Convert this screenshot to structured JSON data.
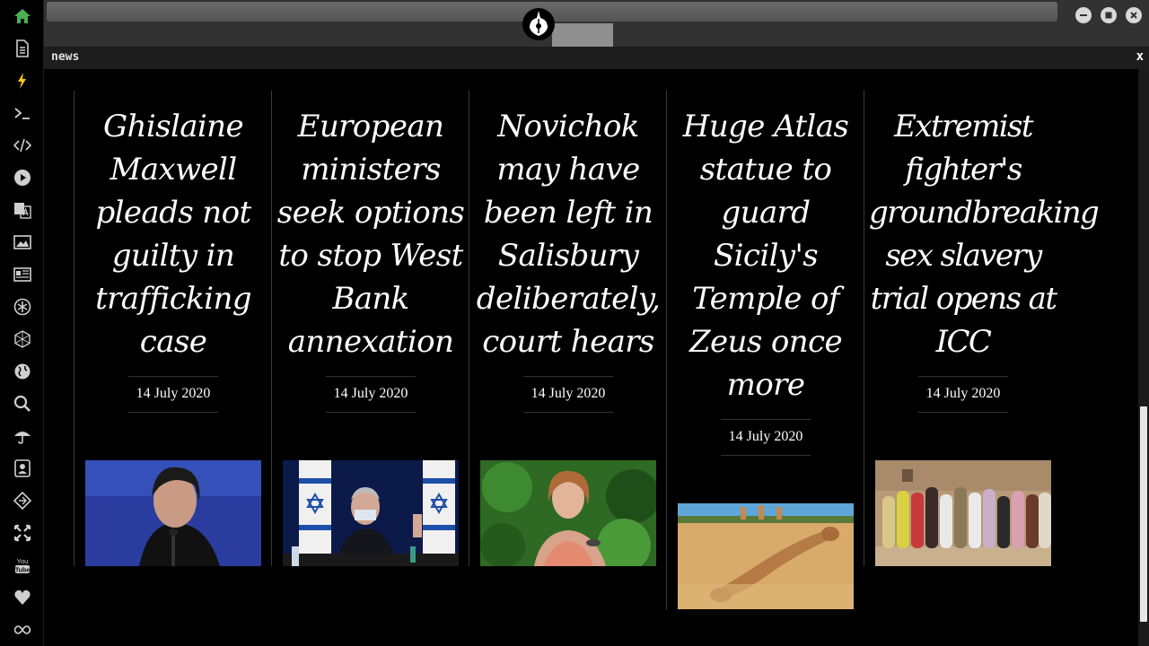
{
  "window": {
    "tab_title": "news",
    "close_glyph": "x"
  },
  "colors": {
    "accent_home": "#4caf50",
    "accent_lightning": "#f5c518",
    "sidebar_icon": "#cfcfcf",
    "background": "#000000"
  },
  "sidebar": {
    "items": [
      {
        "icon": "home-icon"
      },
      {
        "icon": "document-icon"
      },
      {
        "icon": "lightning-icon"
      },
      {
        "icon": "terminal-icon"
      },
      {
        "icon": "code-icon"
      },
      {
        "icon": "play-icon"
      },
      {
        "icon": "translate-icon"
      },
      {
        "icon": "image-icon"
      },
      {
        "icon": "newspaper-icon"
      },
      {
        "icon": "asterisk-icon"
      },
      {
        "icon": "hexagon-icon"
      },
      {
        "icon": "globe-icon"
      },
      {
        "icon": "search-icon"
      },
      {
        "icon": "umbrella-icon"
      },
      {
        "icon": "contact-icon"
      },
      {
        "icon": "git-diff-icon"
      },
      {
        "icon": "expand-icon"
      },
      {
        "icon": "youtube-icon"
      },
      {
        "icon": "heart-icon"
      },
      {
        "icon": "infinity-icon"
      }
    ]
  },
  "articles": [
    {
      "headline": "Ghislaine Maxwell pleads not guilty in trafficking case",
      "date": "14 July 2020",
      "image": "maxwell-photo"
    },
    {
      "headline": "European ministers seek options to stop West Bank annexation",
      "date": "14 July 2020",
      "image": "netanyahu-photo"
    },
    {
      "headline": "Novichok may have been left in Salisbury deliberately, court hears",
      "date": "14 July 2020",
      "image": "woman-portrait-photo"
    },
    {
      "headline": "Huge Atlas statue to guard Sicily's Temple of Zeus once more",
      "date": "14 July 2020",
      "image": "atlas-statue-photo"
    },
    {
      "headline": "Extremist fighter's groundbreaking sex slavery trial opens at ICC",
      "date": "14 July 2020",
      "image": "women-group-photo"
    }
  ]
}
